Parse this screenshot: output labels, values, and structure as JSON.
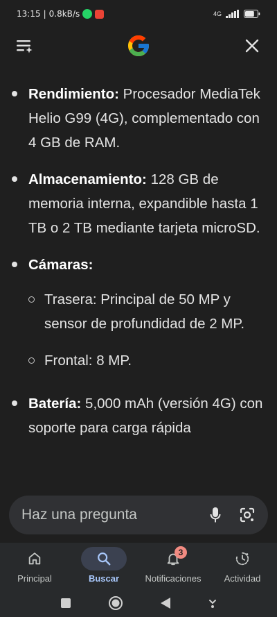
{
  "status": {
    "time": "13:15",
    "net_speed": "0.8kB/s",
    "network": "4G",
    "battery_level": 0.75
  },
  "header": {
    "menu_icon": "menu-sparkle-icon",
    "logo": "google-g-logo",
    "close_icon": "close-icon"
  },
  "content": {
    "items": [
      {
        "label": "Rendimiento:",
        "text": " Procesador MediaTek Helio G99 (4G), complementado con 4 GB de RAM."
      },
      {
        "label": "Almacenamiento:",
        "text": " 128 GB de memoria interna, expandible hasta 1 TB o 2 TB mediante tarjeta microSD."
      },
      {
        "label": "Cámaras:",
        "text": ""
      }
    ],
    "sub_items": [
      "Trasera: Principal de 50 MP y sensor de profundidad de 2 MP.",
      "Frontal: 8 MP."
    ],
    "battery_item": {
      "label": "Batería:",
      "text": " 5,000 mAh (versión 4G) con soporte para carga rápida"
    }
  },
  "ask_bar": {
    "placeholder": "Haz una pregunta",
    "mic_icon": "microphone-icon",
    "lens_icon": "lens-icon"
  },
  "bottom_nav": {
    "items": [
      {
        "label": "Principal",
        "icon": "home-icon"
      },
      {
        "label": "Buscar",
        "icon": "search-icon",
        "active": true
      },
      {
        "label": "Notificaciones",
        "icon": "bell-icon",
        "badge": "3"
      },
      {
        "label": "Actividad",
        "icon": "activity-icon"
      }
    ]
  },
  "colors": {
    "background": "#1f1f1f",
    "active_tab": "#a8c7fa",
    "badge": "#f28b82"
  }
}
